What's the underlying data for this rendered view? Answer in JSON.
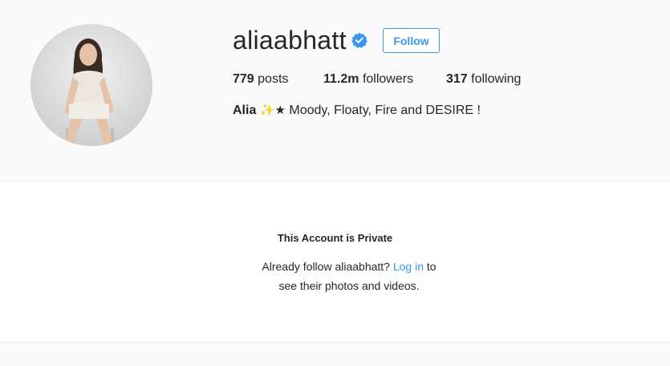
{
  "profile": {
    "username": "aliaabhatt",
    "verified": true,
    "follow_label": "Follow",
    "posts_count": "779",
    "posts_label": "posts",
    "followers_count": "11.2m",
    "followers_label": "followers",
    "following_count": "317",
    "following_label": "following",
    "bio_name": "Alia",
    "bio_sparkle": "✨",
    "bio_star": "★",
    "bio_text": "Moody, Floaty, Fire and DESIRE !"
  },
  "private_notice": {
    "title": "This Account is Private",
    "line1_prefix": "Already follow aliaabhatt?",
    "login_link": "Log in",
    "line1_suffix": "to",
    "line2": "see their photos and videos."
  },
  "colors": {
    "accent": "#3897f0",
    "verified": "#3897f0",
    "text": "#262626",
    "background": "#fafafa"
  },
  "icons": {
    "verified": "verified-badge-icon",
    "avatar": "profile-photo"
  }
}
